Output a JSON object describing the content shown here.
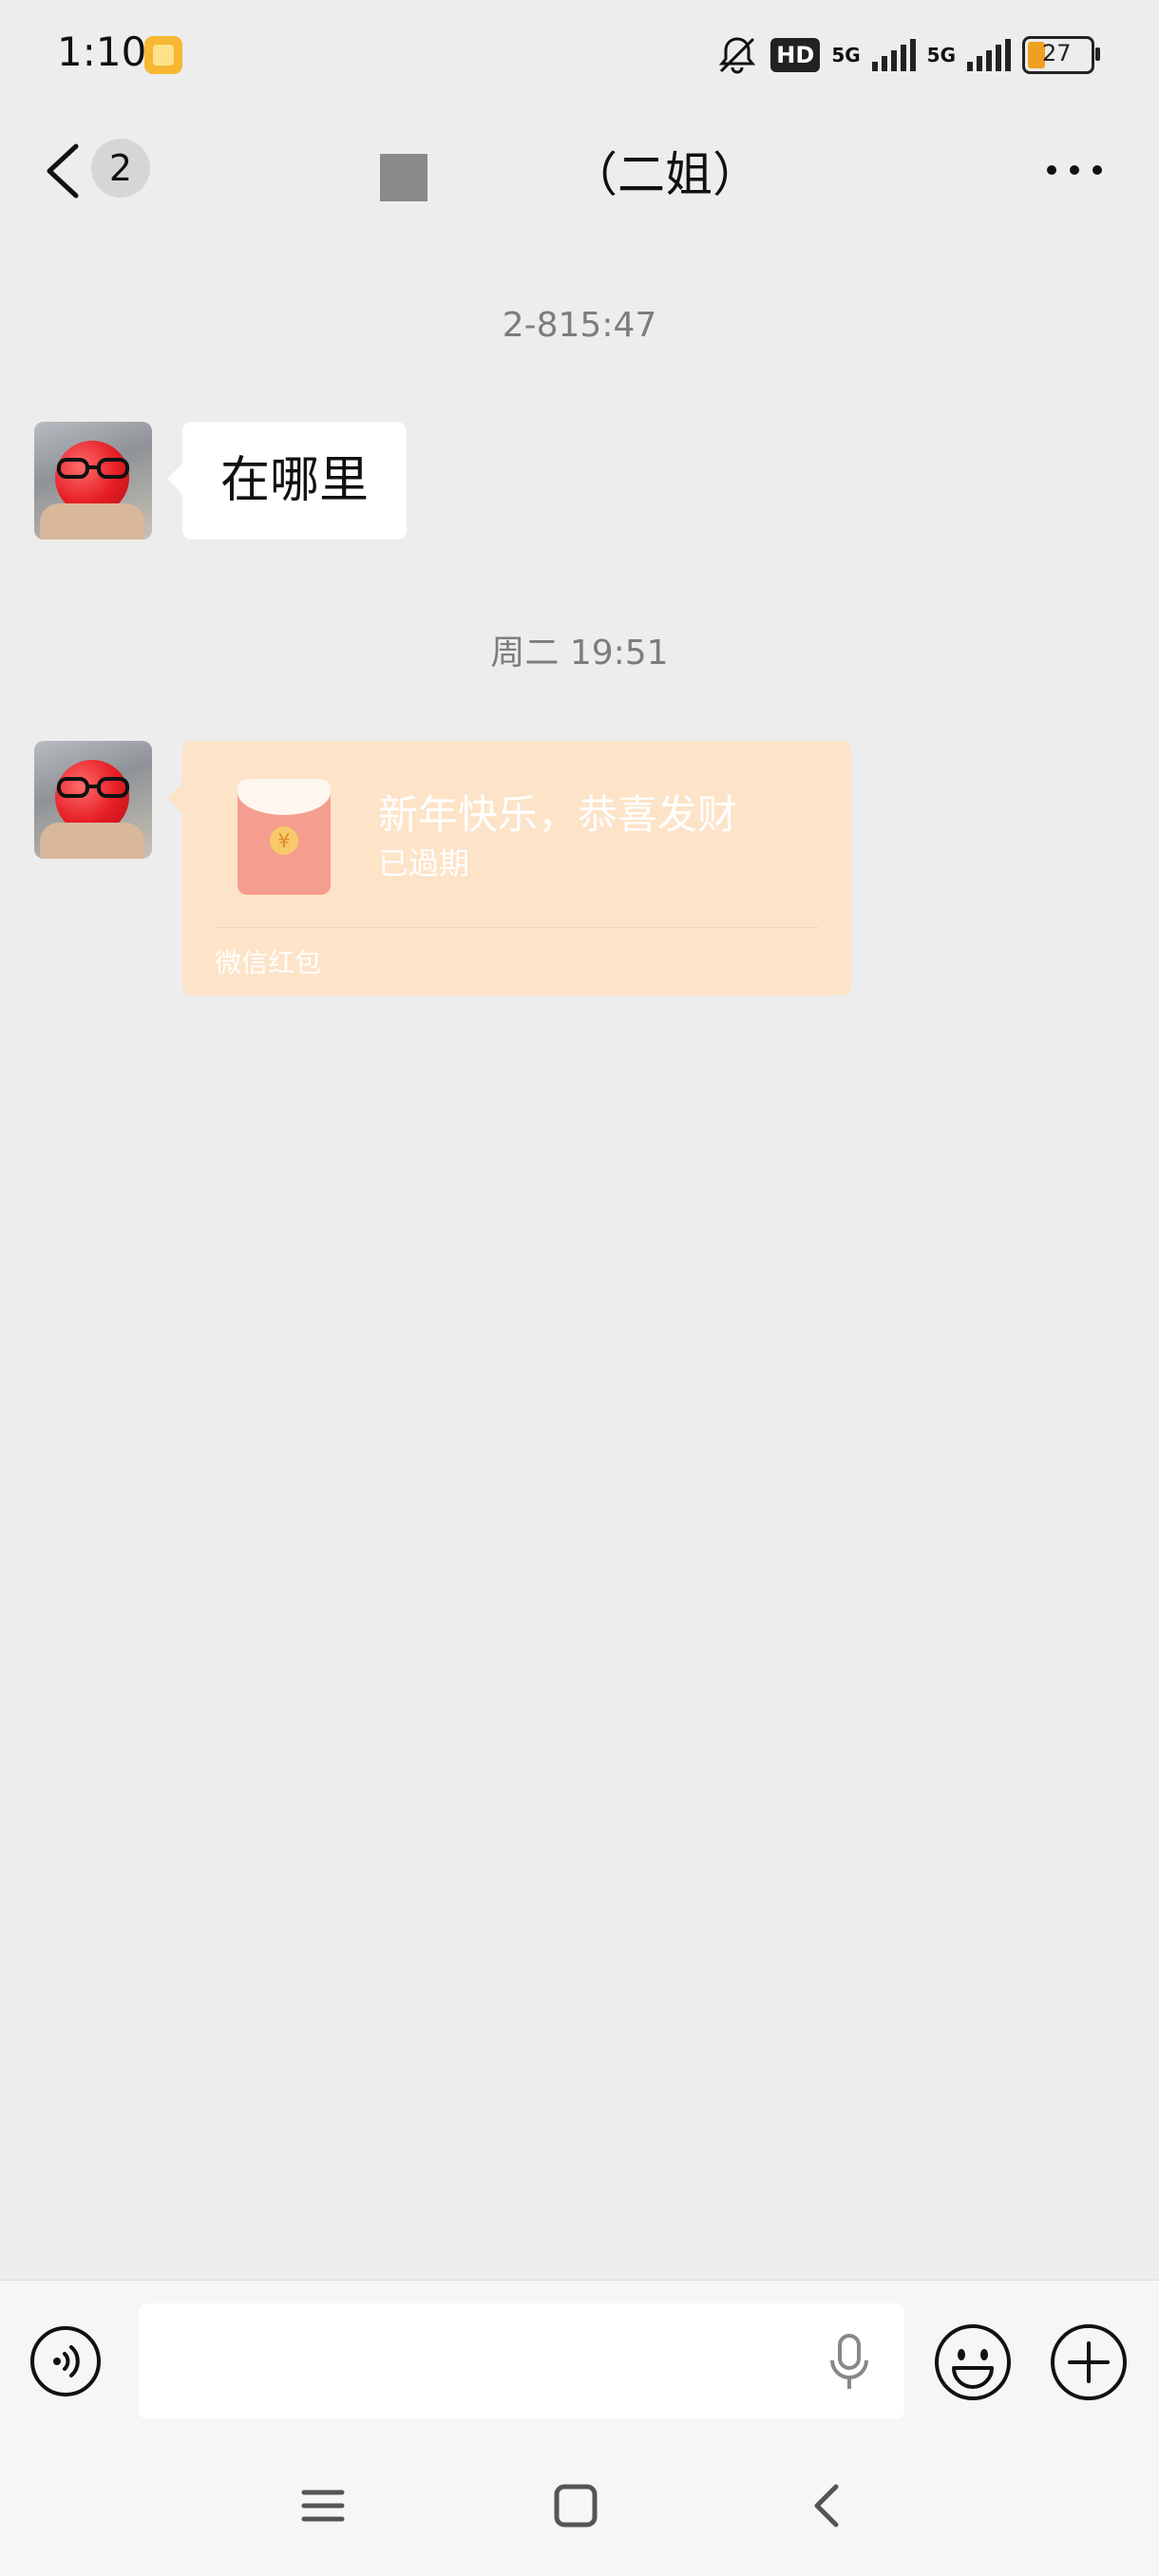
{
  "status_bar": {
    "time": "1:10",
    "hd_label": "HD",
    "network_1": "5G",
    "network_2": "5G",
    "battery_percent": "27",
    "icons": [
      "note-app-icon",
      "mute-bell-icon",
      "hd-voice-icon",
      "signal-icon",
      "signal-icon",
      "battery-icon"
    ]
  },
  "header": {
    "unread_count": "2",
    "title": "（二姐）"
  },
  "messages": [
    {
      "timestamp": "2-815:47",
      "text": "在哪里",
      "type": "text"
    },
    {
      "timestamp": "周二 19:51",
      "type": "red_packet",
      "red_packet": {
        "title": "新年快乐，恭喜发财",
        "status": "已過期",
        "label": "微信红包",
        "coin_symbol": "¥"
      }
    }
  ],
  "input_bar": {
    "placeholder": "",
    "icons": [
      "voice-mode-icon",
      "microphone-icon",
      "emoji-icon",
      "plus-icon"
    ]
  },
  "colors": {
    "background": "#ededed",
    "red_packet_bg": "#fde3c8",
    "red_packet_icon": "#f59d8e"
  }
}
